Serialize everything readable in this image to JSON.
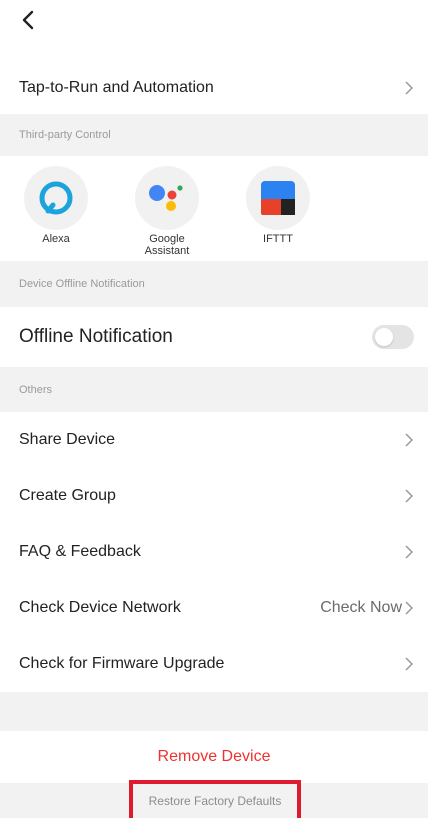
{
  "colors": {
    "accent_red": "#f0322e",
    "highlight_red": "#e01b2f",
    "section_bg": "#f2f2f2"
  },
  "header": {
    "back_icon": "chevron-left-icon"
  },
  "tap_to_run": {
    "label": "Tap-to-Run and Automation"
  },
  "third_party": {
    "section_title": "Third-party Control",
    "items": [
      {
        "label": "Alexa",
        "icon": "alexa-icon"
      },
      {
        "label": "Google\nAssistant",
        "icon": "google-assistant-icon"
      },
      {
        "label": "IFTTT",
        "icon": "ifttt-icon"
      }
    ]
  },
  "offline": {
    "section_title": "Device Offline Notification",
    "label": "Offline Notification",
    "enabled": false
  },
  "others": {
    "section_title": "Others",
    "items": [
      {
        "label": "Share Device",
        "value": ""
      },
      {
        "label": "Create Group",
        "value": ""
      },
      {
        "label": "FAQ & Feedback",
        "value": ""
      },
      {
        "label": "Check Device Network",
        "value": "Check Now"
      },
      {
        "label": "Check for Firmware Upgrade",
        "value": ""
      }
    ]
  },
  "actions": {
    "remove_label": "Remove Device",
    "restore_label": "Restore Factory Defaults"
  }
}
